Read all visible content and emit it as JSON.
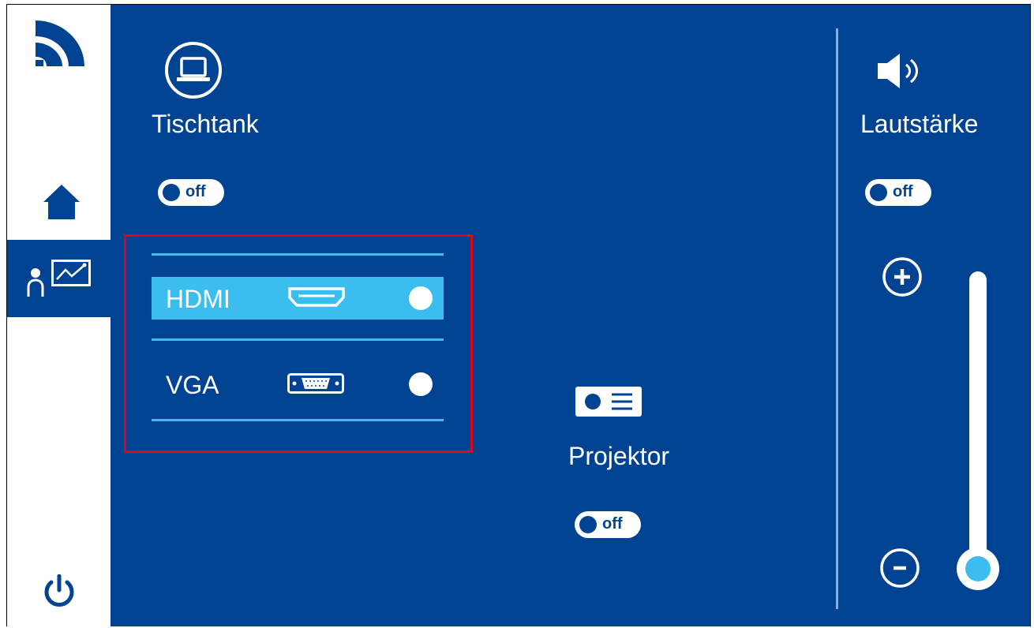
{
  "sidebar": {
    "logo_icon": "brand-logo-icon",
    "items": [
      {
        "icon": "home-icon"
      },
      {
        "icon": "presenter-icon",
        "active": true
      },
      {
        "icon": "power-icon"
      }
    ]
  },
  "tischtank": {
    "icon": "laptop-icon",
    "title": "Tischtank",
    "toggle_label": "off"
  },
  "sources": [
    {
      "label": "HDMI",
      "icon": "hdmi-port-icon",
      "selected": true
    },
    {
      "label": "VGA",
      "icon": "vga-port-icon",
      "selected": false
    }
  ],
  "projektor": {
    "icon": "projector-icon",
    "title": "Projektor",
    "toggle_label": "off"
  },
  "volume": {
    "icon": "speaker-icon",
    "title": "Lautstärke",
    "toggle_label": "off",
    "plus_icon": "plus-circle-icon",
    "minus_icon": "minus-circle-icon",
    "level": 0.0
  },
  "colors": {
    "background": "#004393",
    "accent": "#3cbdf0",
    "highlight_border": "#e3001b",
    "text": "#ffffff"
  }
}
